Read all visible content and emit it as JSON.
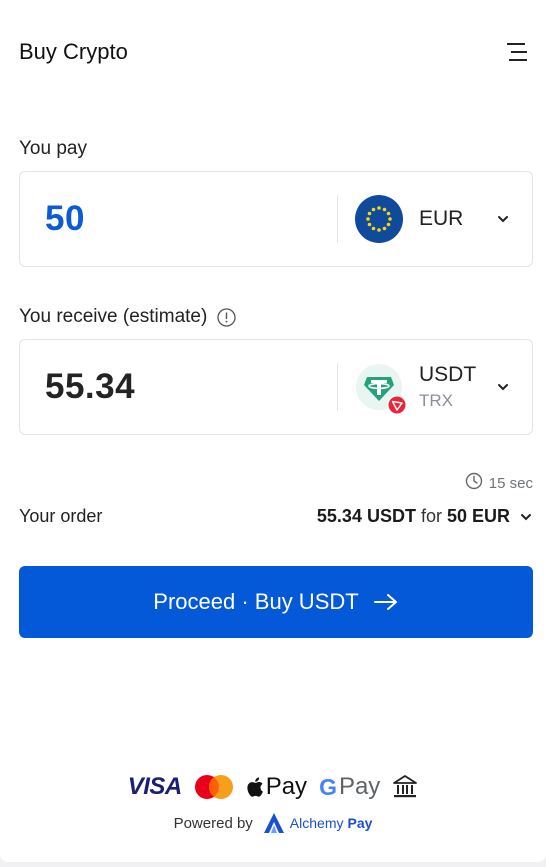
{
  "header": {
    "title": "Buy Crypto"
  },
  "pay": {
    "label": "You pay",
    "amount": "50",
    "currency": "EUR"
  },
  "receive": {
    "label": "You receive (estimate)",
    "amount": "55.34",
    "currency": "USDT",
    "network": "TRX"
  },
  "timer": {
    "text": "15 sec"
  },
  "order": {
    "label": "Your order",
    "crypto_amount": "55.34 USDT",
    "for_word": "for",
    "fiat_amount": "50 EUR"
  },
  "proceed": {
    "label": "Proceed · Buy USDT"
  },
  "payment_methods": {
    "visa": "VISA",
    "apple_pay": "Pay",
    "google_pay_g": "G",
    "google_pay": "Pay"
  },
  "footer": {
    "powered_by": "Powered by",
    "brand_name": "Alchemy",
    "brand_suffix": "Pay"
  },
  "colors": {
    "accent": "#0459d8",
    "pay_amount": "#0b5bd6",
    "eu_blue": "#0f4a9b",
    "tether_green": "#26a17b",
    "tron_red": "#e8263a"
  },
  "icons": [
    "menu-icon",
    "info-icon",
    "eu-flag-icon",
    "tether-icon",
    "tron-icon",
    "chevron-down-icon",
    "clock-icon",
    "arrow-right-icon",
    "mastercard-icon",
    "apple-icon",
    "bank-icon",
    "alchemy-logo-icon"
  ]
}
